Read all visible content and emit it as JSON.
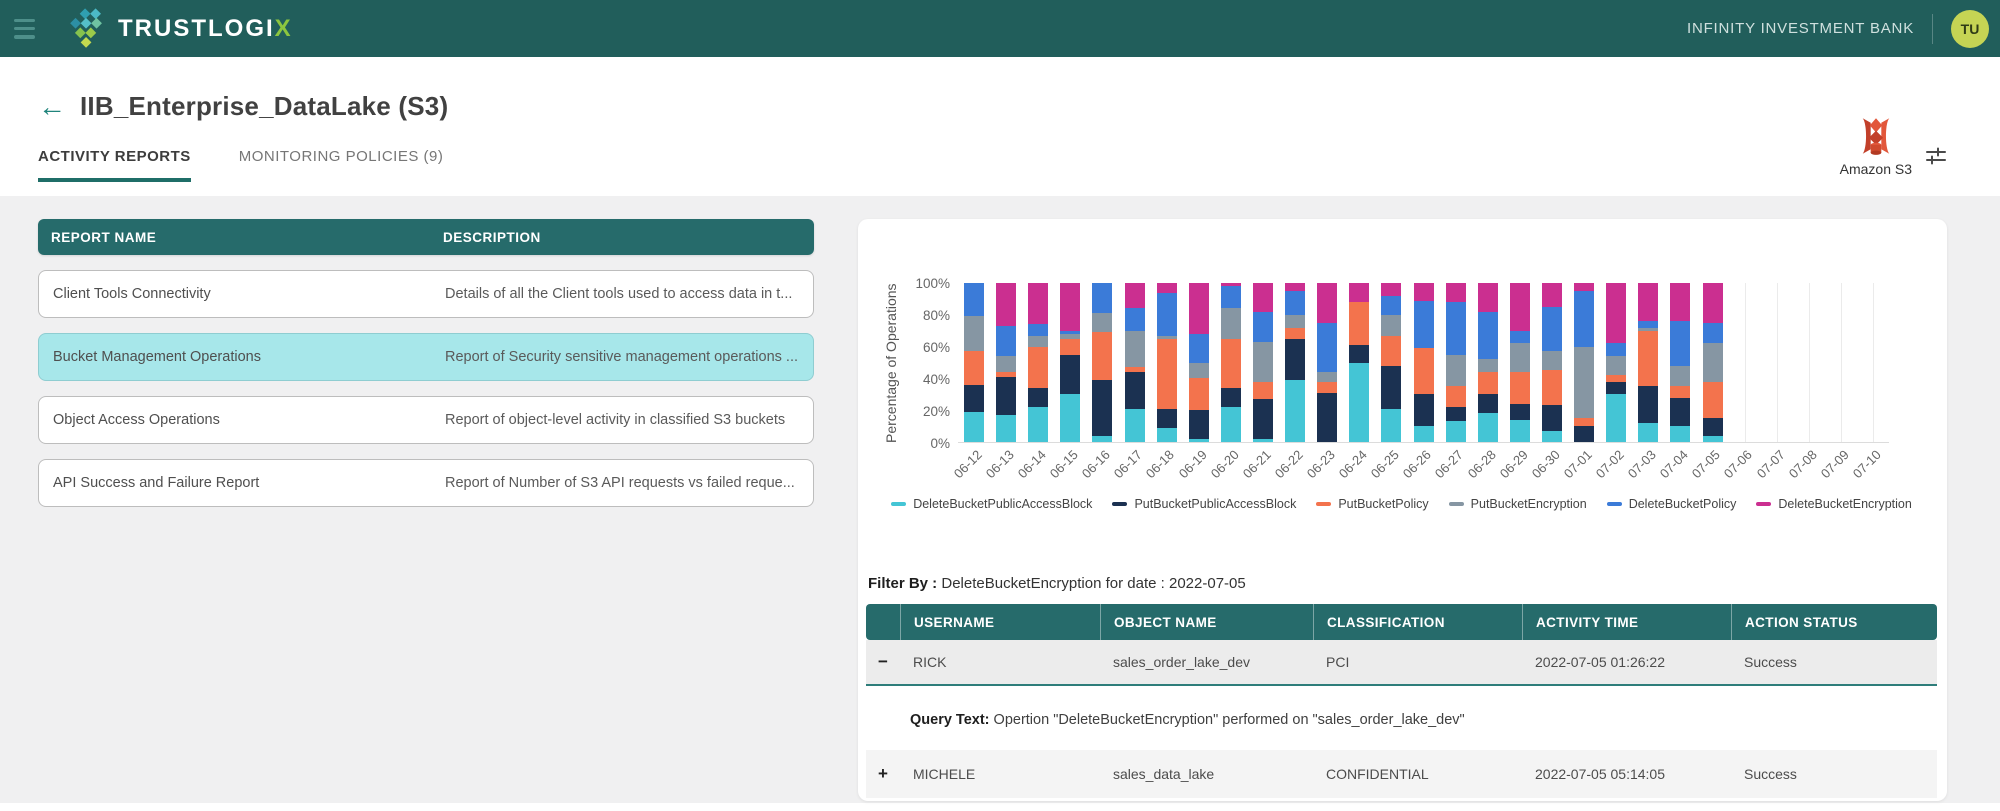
{
  "header": {
    "brand_main": "TRUSTLOGI",
    "brand_accent": "X",
    "tenant": "INFINITY INVESTMENT BANK",
    "avatar_initials": "TU"
  },
  "page": {
    "title": "IIB_Enterprise_DataLake (S3)",
    "datasource_label": "Amazon S3",
    "tabs": [
      {
        "label": "ACTIVITY REPORTS",
        "active": true
      },
      {
        "label": "MONITORING POLICIES (9)",
        "active": false
      }
    ]
  },
  "reports": {
    "columns": [
      "REPORT NAME",
      "DESCRIPTION"
    ],
    "rows": [
      {
        "name": "Client Tools Connectivity",
        "description": "Details of all the Client tools used to access data in t...",
        "selected": false
      },
      {
        "name": "Bucket Management Operations",
        "description": "Report of Security sensitive management operations ...",
        "selected": true
      },
      {
        "name": "Object Access Operations",
        "description": "Report of object-level activity in classified S3 buckets",
        "selected": false
      },
      {
        "name": "API Success and Failure Report",
        "description": "Report of Number of S3 API requests vs failed reque...",
        "selected": false
      }
    ]
  },
  "chart_data": {
    "type": "bar",
    "stacked": true,
    "percentage": true,
    "ylabel": "Percentage of Operations",
    "yticks": [
      "0%",
      "20%",
      "40%",
      "60%",
      "80%",
      "100%"
    ],
    "ylim": [
      0,
      100
    ],
    "grid": "vertical",
    "legend_position": "bottom",
    "categories": [
      "06-12",
      "06-13",
      "06-14",
      "06-15",
      "06-16",
      "06-17",
      "06-18",
      "06-19",
      "06-20",
      "06-21",
      "06-22",
      "06-23",
      "06-24",
      "06-25",
      "06-26",
      "06-27",
      "06-28",
      "06-29",
      "06-30",
      "07-01",
      "07-02",
      "07-03",
      "07-04",
      "07-05",
      "07-06",
      "07-07",
      "07-08",
      "07-09",
      "07-10"
    ],
    "series": [
      {
        "name": "DeleteBucketPublicAccessBlock",
        "color": "#44C5D5",
        "values": [
          19,
          17,
          22,
          30,
          4,
          21,
          9,
          2,
          22,
          2,
          39,
          0,
          50,
          21,
          10,
          13,
          18,
          14,
          7,
          0,
          30,
          12,
          10,
          4,
          0,
          0,
          0,
          0,
          0
        ]
      },
      {
        "name": "PutBucketPublicAccessBlock",
        "color": "#1B3151",
        "values": [
          17,
          24,
          12,
          25,
          35,
          23,
          12,
          18,
          12,
          25,
          26,
          31,
          11,
          27,
          20,
          9,
          12,
          10,
          16,
          10,
          8,
          23,
          18,
          11,
          0,
          0,
          0,
          0,
          0
        ]
      },
      {
        "name": "PutBucketPolicy",
        "color": "#F3734D",
        "values": [
          21,
          3,
          26,
          10,
          30,
          3,
          44,
          20,
          31,
          11,
          7,
          7,
          27,
          19,
          29,
          13,
          14,
          20,
          22,
          5,
          4,
          35,
          7,
          23,
          0,
          0,
          0,
          0,
          0
        ]
      },
      {
        "name": "PutBucketEncryption",
        "color": "#8696A3",
        "values": [
          22,
          10,
          7,
          3,
          12,
          23,
          2,
          10,
          19,
          25,
          8,
          6,
          0,
          13,
          0,
          20,
          8,
          18,
          12,
          45,
          12,
          2,
          13,
          24,
          0,
          0,
          0,
          0,
          0
        ]
      },
      {
        "name": "DeleteBucketPolicy",
        "color": "#3B7BD8",
        "values": [
          21,
          19,
          7,
          2,
          19,
          14,
          27,
          18,
          14,
          19,
          15,
          31,
          0,
          12,
          30,
          33,
          30,
          8,
          28,
          35,
          8,
          4,
          28,
          13,
          0,
          0,
          0,
          0,
          0
        ]
      },
      {
        "name": "DeleteBucketEncryption",
        "color": "#CB2F90",
        "values": [
          0,
          27,
          26,
          30,
          0,
          16,
          6,
          32,
          2,
          18,
          5,
          25,
          12,
          8,
          11,
          12,
          18,
          30,
          15,
          5,
          38,
          24,
          24,
          25,
          0,
          0,
          0,
          0,
          0
        ]
      }
    ]
  },
  "filter": {
    "label": "Filter By :",
    "value": "DeleteBucketEncryption for date : 2022-07-05"
  },
  "activity_table": {
    "columns": [
      "USERNAME",
      "OBJECT NAME",
      "CLASSIFICATION",
      "ACTIVITY TIME",
      "ACTION STATUS"
    ],
    "rows": [
      {
        "expand_icon": "−",
        "expanded": true,
        "username": "RICK",
        "object_name": "sales_order_lake_dev",
        "classification": "PCI",
        "activity_time": "2022-07-05 01:26:22",
        "action_status": "Success",
        "query_label": "Query Text:",
        "query_text": "Opertion \"DeleteBucketEncryption\" performed on \"sales_order_lake_dev\""
      },
      {
        "expand_icon": "+",
        "expanded": false,
        "username": "MICHELE",
        "object_name": "sales_data_lake",
        "classification": "CONFIDENTIAL",
        "activity_time": "2022-07-05 05:14:05",
        "action_status": "Success"
      }
    ]
  },
  "colors": {
    "appbar": "#215E5B",
    "table_header": "#266B6B",
    "selected_row": "#A7E7EA",
    "tab_underline": "#1F6E68",
    "avatar_bg": "#C5D454",
    "brand_accent": "#8CC63F",
    "content_bg": "#F0F0F1"
  }
}
